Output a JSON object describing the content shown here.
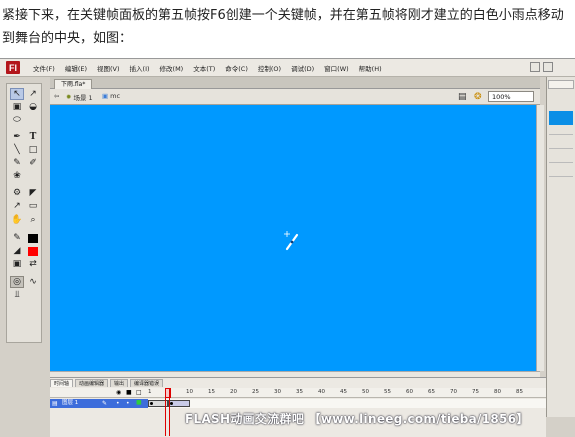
{
  "intro_text": "紧接下来，在关键帧面板的第五帧按F6创建一个关键帧，并在第五帧将刚才建立的白色小雨点移动到舞台的中央，如图：",
  "menubar": {
    "logo": "Fl",
    "items": [
      "文件(F)",
      "编辑(E)",
      "视图(V)",
      "插入(I)",
      "修改(M)",
      "文本(T)",
      "命令(C)",
      "控制(O)",
      "调试(D)",
      "窗口(W)",
      "帮助(H)"
    ]
  },
  "document_tab": "下雨.fla*",
  "breadcrumb": {
    "scene": "场景 1",
    "symbol": "mc"
  },
  "zoom": "100%",
  "stage_color": "#0099ff",
  "timeline": {
    "tabs": [
      "时间轴",
      "动画编辑器",
      "输出",
      "编译器错误"
    ],
    "frame_labels": [
      "1",
      "5",
      "10",
      "15",
      "20",
      "25",
      "30",
      "35",
      "40",
      "45",
      "50",
      "55",
      "60",
      "65",
      "70",
      "75",
      "80",
      "85"
    ],
    "layer_name": "图层 1",
    "current_frame": 5
  },
  "watermark": "FLASH动画交流群吧 【www.lineeg.com/tieba/1856】"
}
